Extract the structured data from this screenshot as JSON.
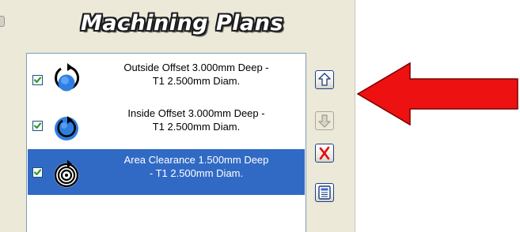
{
  "panel": {
    "title": "Machining Plans"
  },
  "plans": [
    {
      "line1": "Outside Offset 3.000mm Deep -",
      "line2": "T1 2.500mm Diam.",
      "checked": true,
      "selected": false,
      "icon": "outside-offset-icon"
    },
    {
      "line1": "Inside Offset 3.000mm Deep -",
      "line2": "T1 2.500mm Diam.",
      "checked": true,
      "selected": false,
      "icon": "inside-offset-icon"
    },
    {
      "line1": "Area Clearance 1.500mm Deep",
      "line2": "- T1 2.500mm Diam.",
      "checked": true,
      "selected": true,
      "icon": "area-clearance-icon"
    }
  ],
  "buttons": [
    {
      "name": "move-up-button",
      "icon": "up-arrow-icon",
      "enabled": true
    },
    {
      "name": "move-down-button",
      "icon": "down-arrow-icon",
      "enabled": false
    },
    {
      "name": "delete-button",
      "icon": "red-x-icon",
      "enabled": true
    },
    {
      "name": "properties-button",
      "icon": "sheet-icon",
      "enabled": true
    }
  ],
  "colors": {
    "panel_bg": "#ece9d8",
    "selection": "#316ac5",
    "icon_blue": "#2f7fe0",
    "annotation_arrow": "#ee1111",
    "check_green": "#2a9e2a"
  }
}
